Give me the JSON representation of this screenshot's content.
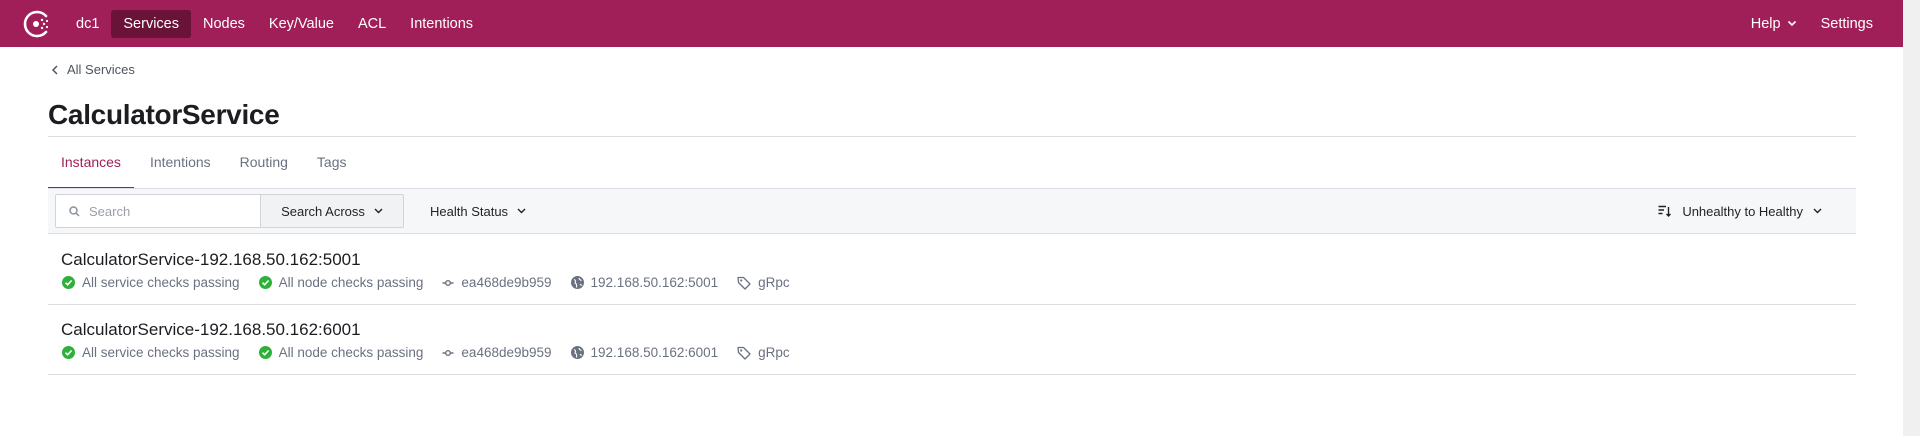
{
  "topbar": {
    "background": "#a11f58",
    "logo_icon": "consul-logo-icon",
    "nav": [
      {
        "label": "dc1",
        "active": false
      },
      {
        "label": "Services",
        "active": true
      },
      {
        "label": "Nodes",
        "active": false
      },
      {
        "label": "Key/Value",
        "active": false
      },
      {
        "label": "ACL",
        "active": false
      },
      {
        "label": "Intentions",
        "active": false
      }
    ],
    "help_label": "Help",
    "settings_label": "Settings"
  },
  "breadcrumb": {
    "label": "All Services"
  },
  "page": {
    "title": "CalculatorService"
  },
  "tabs": [
    {
      "label": "Instances",
      "active": true
    },
    {
      "label": "Intentions",
      "active": false
    },
    {
      "label": "Routing",
      "active": false
    },
    {
      "label": "Tags",
      "active": false
    }
  ],
  "filters": {
    "search_placeholder": "Search",
    "search_across_label": "Search Across",
    "health_status_label": "Health Status",
    "sort_label": "Unhealthy to Healthy"
  },
  "instances": [
    {
      "name": "CalculatorService-192.168.50.162:5001",
      "service_checks": "All service checks passing",
      "node_checks": "All node checks passing",
      "node": "ea468de9b959",
      "address": "192.168.50.162:5001",
      "tag": "gRpc"
    },
    {
      "name": "CalculatorService-192.168.50.162:6001",
      "service_checks": "All service checks passing",
      "node_checks": "All node checks passing",
      "node": "ea468de9b959",
      "address": "192.168.50.162:6001",
      "tag": "gRpc"
    }
  ],
  "colors": {
    "accent": "#a11f58",
    "nav_active": "#6a1238",
    "passing": "#2eb039",
    "muted_text": "#6a7180"
  }
}
